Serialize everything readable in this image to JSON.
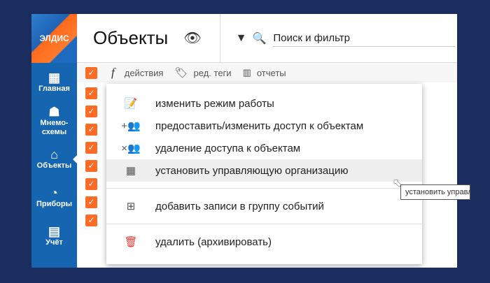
{
  "logo": "ЭЛДИС",
  "sidebar": {
    "items": [
      {
        "label": "Главная",
        "icon": "dashboard-icon"
      },
      {
        "label": "Мнемо-схемы",
        "icon": "hierarchy-icon"
      },
      {
        "label": "Объекты",
        "icon": "home-icon",
        "active": true
      },
      {
        "label": "Приборы",
        "icon": "gauge-icon"
      },
      {
        "label": "Учёт",
        "icon": "calculator-icon"
      }
    ]
  },
  "header": {
    "title": "Объекты",
    "search_placeholder": "Поиск и фильтр"
  },
  "toolbar": {
    "actions": "действия",
    "tags": "ред. теги",
    "reports": "отчеты"
  },
  "menu": {
    "items": [
      {
        "label": "изменить режим работы",
        "icon": "calendar-edit-icon"
      },
      {
        "label": "предоставить/изменить доступ к объектам",
        "icon": "add-users-icon"
      },
      {
        "label": "удаление доступа к объектам",
        "icon": "remove-users-icon"
      },
      {
        "label": "установить управляющую организацию",
        "icon": "building-icon"
      },
      {
        "label": "добавить записи в группу событий",
        "icon": "add-to-group-icon"
      },
      {
        "label": "удалить (архивировать)",
        "icon": "trash-icon"
      }
    ]
  },
  "tooltip": "установить управляющую организацию",
  "colors": {
    "accent": "#ff6a24",
    "sidebar": "#1565b0",
    "background": "#1b2c5e",
    "delete": "#e53935"
  }
}
